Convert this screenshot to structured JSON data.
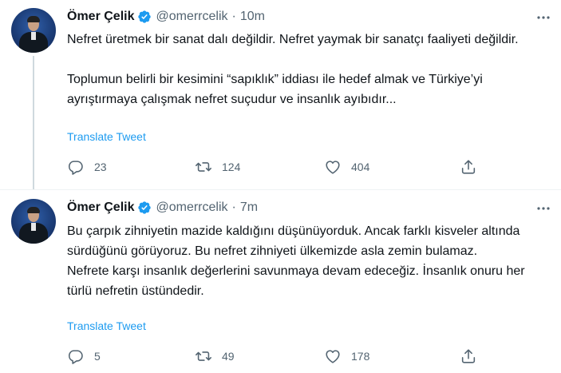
{
  "tweets": [
    {
      "author": "Ömer Çelik",
      "handle": "@omerrcelik",
      "separator": "·",
      "time": "10m",
      "paragraphs": [
        "Nefret üretmek bir sanat dalı değildir. Nefret yaymak bir sanatçı faaliyeti değildir.",
        "Toplumun belirli bir kesimini “sapıklık” iddiası ile hedef almak ve Türkiye’yi ayrıştırmaya çalışmak nefret suçudur ve insanlık ayıbıdır..."
      ],
      "translate_label": "Translate Tweet",
      "replies": "23",
      "retweets": "124",
      "likes": "404"
    },
    {
      "author": "Ömer Çelik",
      "handle": "@omerrcelik",
      "separator": "·",
      "time": "7m",
      "paragraphs": [
        "Bu çarpık zihniyetin mazide kaldığını düşünüyorduk. Ancak farklı kisveler altında sürdüğünü görüyoruz. Bu nefret zihniyeti ülkemizde asla zemin bulamaz.",
        "Nefrete karşı insanlık değerlerini savunmaya devam edeceğiz. İnsanlık onuru her türlü nefretin üstündedir."
      ],
      "translate_label": "Translate Tweet",
      "replies": "5",
      "retweets": "49",
      "likes": "178"
    }
  ],
  "icons": {
    "verified": "verified-badge-icon",
    "more": "more-options-icon",
    "reply": "reply-icon",
    "retweet": "retweet-icon",
    "like": "like-icon",
    "share": "share-icon"
  },
  "colors": {
    "verified": "#1d9bf0",
    "link": "#1d9bf0",
    "muted": "#536471",
    "text": "#0f1419"
  }
}
